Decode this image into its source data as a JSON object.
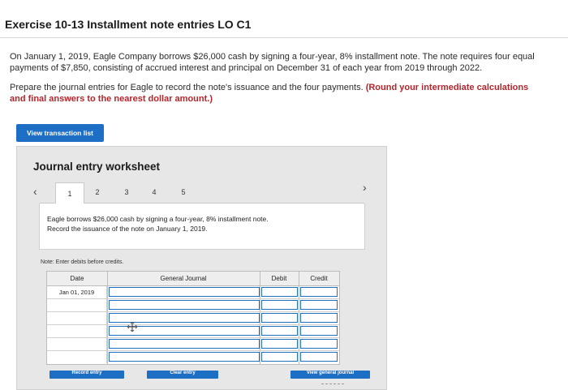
{
  "header": {
    "title": "Exercise 10-13 Installment note entries LO C1"
  },
  "problem": {
    "paragraph1": "On January 1, 2019, Eagle Company borrows $26,000 cash by signing a four-year, 8% installment note. The note requires four equal payments of $7,850, consisting of accrued interest and principal on December 31 of each year from 2019 through 2022.",
    "paragraph2_plain": "Prepare the journal entries for Eagle to record the note's issuance and the four payments. ",
    "paragraph2_bold": "(Round your intermediate calculations and final answers to the nearest dollar amount.)"
  },
  "actions": {
    "view_transaction_list": "View transaction list"
  },
  "worksheet": {
    "title": "Journal entry worksheet",
    "prev_icon": "chevron-left-icon",
    "next_icon": "chevron-right-icon",
    "tabs": [
      {
        "label": "1",
        "active": true
      },
      {
        "label": "2",
        "active": false
      },
      {
        "label": "3",
        "active": false
      },
      {
        "label": "4",
        "active": false
      },
      {
        "label": "5",
        "active": false
      }
    ],
    "prompt_line1": "Eagle borrows $26,000 cash by signing a four-year, 8% installment note.",
    "prompt_line2": "Record the issuance of the note on January 1, 2019.",
    "note": "Note: Enter debits before credits.",
    "journal": {
      "columns": {
        "date": "Date",
        "general_journal": "General Journal",
        "debit": "Debit",
        "credit": "Credit"
      },
      "rows": [
        {
          "date": "Jan 01, 2019"
        },
        {
          "date": ""
        },
        {
          "date": ""
        },
        {
          "date": ""
        },
        {
          "date": ""
        },
        {
          "date": ""
        }
      ]
    },
    "buttons": {
      "record_entry": "Record entry",
      "clear_entry": "Clear entry",
      "view_general_journal": "View general journal"
    }
  },
  "colors": {
    "accent_blue": "#1d6fc6",
    "bold_red": "#b5252b",
    "panel_gray": "#e7e7e7"
  }
}
